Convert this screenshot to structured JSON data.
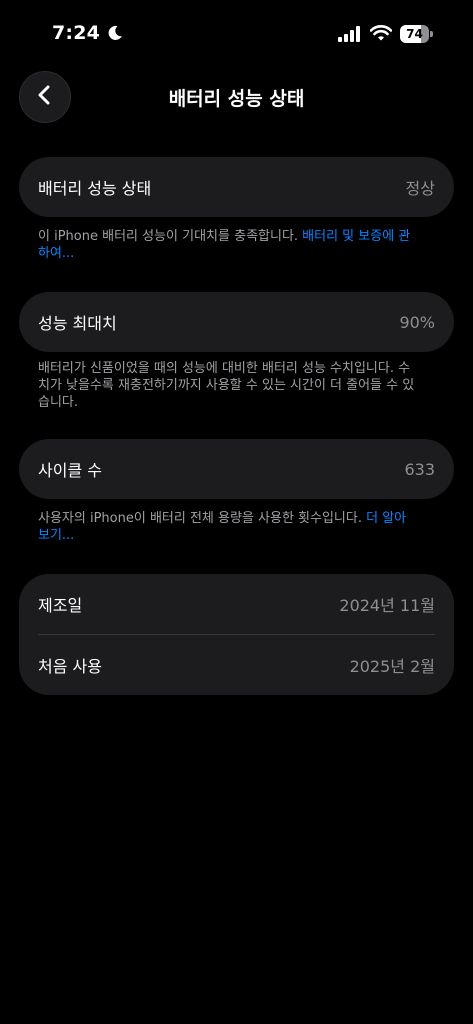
{
  "status_bar": {
    "time": "7:24",
    "battery_level": "74",
    "battery_fraction": 0.74,
    "icons": [
      "moon-icon",
      "signal-icon",
      "wifi-icon",
      "battery-icon"
    ]
  },
  "nav": {
    "back_icon": "chevron-left-icon",
    "title": "배터리 성능 상태"
  },
  "health_card": {
    "label": "배터리 성능 상태",
    "value": "정상"
  },
  "health_note": {
    "text": "이 iPhone 배터리 성능이 기대치를 충족합니다. ",
    "link": "배터리 및 보증에 관하여..."
  },
  "max_capacity_card": {
    "label": "성능 최대치",
    "value": "90%"
  },
  "max_capacity_note": {
    "text": "배터리가 신품이었을 때의 성능에 대비한 배터리 성능 수치입니다. 수치가 낮을수록 재충전하기까지 사용할 수 있는 시간이 더 줄어들 수 있습니다."
  },
  "cycle_card": {
    "label": "사이클 수",
    "value": "633"
  },
  "cycle_note": {
    "text": "사용자의 iPhone이 배터리 전체 용량을 사용한 횟수입니다. ",
    "link": "더 알아보기..."
  },
  "dates_card": {
    "manufacture_label": "제조일",
    "manufacture_value": "2024년 11월",
    "first_use_label": "처음 사용",
    "first_use_value": "2025년 2월"
  },
  "colors": {
    "background": "#000000",
    "card": "#1c1c1e",
    "link": "#0a84ff",
    "secondary_text": "#8e8e93"
  }
}
